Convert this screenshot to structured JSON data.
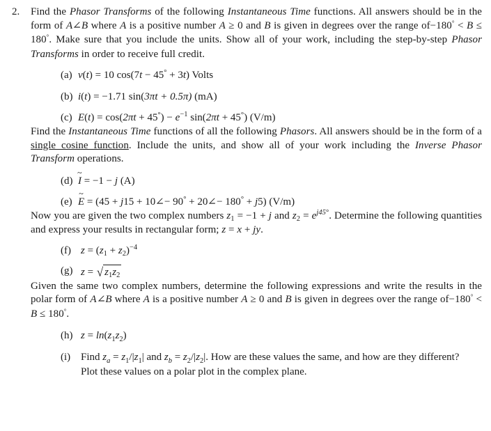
{
  "document": {
    "problem_number": "2.",
    "intro_paragraph": "Find the Phasor Transforms of the following Instantaneous Time functions. All answers should be in the form of A∠B where A is a positive number A ≥ 0 and B is given in degrees over the range of−180° < B ≤ 180°. Make sure that you include the units. Show all of your work, including the step-by-step Phasor Transforms in order to receive full credit.",
    "intro_segments": {
      "s1": "Find the ",
      "s2": "Phasor Transforms",
      "s3": " of the following ",
      "s4": "Instantaneous Time",
      "s5": " functions. All answers should be in the form of ",
      "s6": "A",
      "s7": "B",
      "s8": " where ",
      "s9": "A",
      "s10": " is a positive number ",
      "s11": "A",
      "s12": " ≥ 0 and ",
      "s13": "B",
      "s14": " is given in degrees over the range of−180",
      "s15": " < ",
      "s16": "B",
      "s17": " ≤ 180",
      "s18": ". Make sure that you include the units. Show all of your work, including the step-by-step ",
      "s19": "Phasor Transforms",
      "s20": " in order to receive full credit."
    },
    "part_a": {
      "label": "(a)",
      "text": "v(t) = 10 cos(7t − 45° + 3t) Volts",
      "func": "v",
      "arg": "t",
      "amplitude": "10",
      "trig": "cos",
      "inner_1": "7",
      "inner_t1": "t",
      "inner_2": " − 45",
      "inner_3": " + 3",
      "inner_t2": "t",
      "units": " Volts"
    },
    "part_b": {
      "label": "(b)",
      "text": "i(t) = −1.71 sin(3πt + 0.5π) (mA)",
      "func": "i",
      "arg": "t",
      "amplitude": "−1.71",
      "trig": "sin",
      "inner": "(3πt + 0.5π)",
      "inner_1": "3π",
      "inner_t": "t",
      "inner_2": " + 0.5π)",
      "units": " (mA)"
    },
    "part_c": {
      "label": "(c)",
      "text": "E(t) = cos(2πt + 45°) − e⁻¹ sin(2πt + 45°) (V/m)",
      "func": "E",
      "arg": "t",
      "trig1": "cos",
      "term1_1": "2π",
      "term1_t": "t",
      "term1_2": " + 45",
      "minus": " − ",
      "e_base": "e",
      "e_exp": "−1",
      "trig2": "sin",
      "term2_1": "2π",
      "term2_t": "t",
      "term2_2": " + 45",
      "units": " (V/m)"
    },
    "mid_paragraph": "Find the Instantaneous Time functions of all the following Phasors. All answers should be in the form of a single cosine function. Include the units, and show all of your work including the Inverse Phasor Transform operations.",
    "mid_segments": {
      "s1": "Find the ",
      "s2": "Instantaneous Time",
      "s3": " functions of all the following ",
      "s4": "Phasors",
      "s5": ". All answers should be in the form of a ",
      "s6": "single cosine function",
      "s7": ". Include the units, and show all of your work including the ",
      "s8": "Inverse Phasor Transform",
      "s9": " operations."
    },
    "part_d": {
      "label": "(d)",
      "text": "Ĩ = −1 − j (A)",
      "symbol": "I",
      "accent": "~",
      "value": " = −1 − ",
      "j": "j",
      "units": "  (A)"
    },
    "part_e": {
      "label": "(e)",
      "text": "Ẽ = (45 + j15 + 10∠− 90° + 20∠− 180° + j5) (V/m)",
      "symbol": "E",
      "accent": "~",
      "eq_open": " = (45 + ",
      "j1": "j",
      "seg1": "15 + 10",
      "seg2": "− 90",
      "seg3": " + 20",
      "seg4": "− 180",
      "seg5": " + ",
      "j2": "j",
      "seg6": "5) (V/m)"
    },
    "complex_paragraph": "Now you are given the two complex numbers z₁ = −1 + j and z₂ = e^{j45°}. Determine the following quantities and express your results in rectangular form; z = x + jy.",
    "complex_segments": {
      "s1": "Now you are given the two complex numbers ",
      "z1": "z",
      "z1sub": "1",
      "s2": " = −1 + ",
      "j1": "j",
      "s3": " and ",
      "z2": "z",
      "z2sub": "2",
      "s4": " = ",
      "e": "e",
      "exp": "j45",
      "s5": ". Determine the following quantities and express your results in rectangular form; ",
      "z": "z",
      "s6": " = ",
      "x": "x",
      "s7": " + ",
      "j2": "j",
      "y": "y",
      "s8": "."
    },
    "part_f": {
      "label": "(f)",
      "text": "z = (z₁ + z₂)⁻⁴",
      "z": "z",
      "eq": " = (",
      "z1": "z",
      "z1sub": "1",
      "plus": " + ",
      "z2": "z",
      "z2sub": "2",
      "close": ")",
      "exp": "−4"
    },
    "part_g": {
      "label": "(g)",
      "text": "z = √(z₁z₂)",
      "z": "z",
      "eq": " = ",
      "radical": "√",
      "r_z1": "z",
      "r_z1sub": "1",
      "r_z2": "z",
      "r_z2sub": "2"
    },
    "polar_paragraph": "Given the same two complex numbers, determine the following expressions and write the results in the polar form of A∠B where A is a positive number A ≥ 0 and B is given in degrees over the range of−180° < B ≤ 180°.",
    "polar_segments": {
      "s1": "Given the same two complex numbers, determine the following expressions and write the results in the polar form of ",
      "a1": "A",
      "b1": "B",
      "s2": " where ",
      "a2": "A",
      "s3": " is a positive number ",
      "a3": "A",
      "s4": " ≥ 0 and ",
      "b2": "B",
      "s5": " is given in degrees over the range of−180",
      "s6": " < ",
      "b3": "B",
      "s7": " ≤ 180",
      "s8": "."
    },
    "part_h": {
      "label": "(h)",
      "text": "z = ln(z₁z₂)",
      "z": "z",
      "eq": " = ",
      "ln": "ln",
      "open": "(",
      "z1": "z",
      "z1sub": "1",
      "z2": "z",
      "z2sub": "2",
      "close": ")"
    },
    "part_i": {
      "label": "(i)",
      "text": "Find z_a = z₁/|z₁| and z_b = z₂/|z₂|. How are these values the same, and how are they different? Plot these values on a polar plot in the complex plane.",
      "s1": "Find ",
      "za": "z",
      "zasub": "a",
      "s2": " = ",
      "z1": "z",
      "z1sub": "1",
      "s3": "/|",
      "z1b": "z",
      "z1bsub": "1",
      "s4": "| and ",
      "zb": "z",
      "zbsub": "b",
      "s5": " = ",
      "z2": "z",
      "z2sub": "2",
      "s6": "/|",
      "z2b": "z",
      "z2bsub": "2",
      "s7": "|. How are these values the same, and how are they different? Plot these values on a polar plot in the complex plane."
    },
    "symbols": {
      "degree": "°",
      "angle": "∠"
    }
  }
}
